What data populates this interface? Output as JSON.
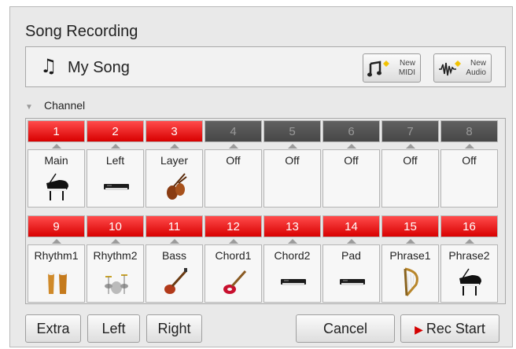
{
  "window": {
    "title": "Song Recording"
  },
  "song": {
    "name": "My Song",
    "note_glyph": "♫"
  },
  "new_buttons": [
    {
      "line1": "New",
      "line2": "MIDI",
      "icon": "midi-note-icon"
    },
    {
      "line1": "New",
      "line2": "Audio",
      "icon": "audio-wave-icon"
    }
  ],
  "channel_section": {
    "label": "Channel"
  },
  "channels_row1": [
    {
      "num": "1",
      "voice": "Main",
      "active": true,
      "icon": "grand-piano-icon"
    },
    {
      "num": "2",
      "voice": "Left",
      "active": true,
      "icon": "keyboard-icon"
    },
    {
      "num": "3",
      "voice": "Layer",
      "active": true,
      "icon": "strings-icon"
    },
    {
      "num": "4",
      "voice": "Off",
      "active": false,
      "icon": ""
    },
    {
      "num": "5",
      "voice": "Off",
      "active": false,
      "icon": ""
    },
    {
      "num": "6",
      "voice": "Off",
      "active": false,
      "icon": ""
    },
    {
      "num": "7",
      "voice": "Off",
      "active": false,
      "icon": ""
    },
    {
      "num": "8",
      "voice": "Off",
      "active": false,
      "icon": ""
    }
  ],
  "channels_row2": [
    {
      "num": "9",
      "voice": "Rhythm1",
      "active": true,
      "icon": "conga-icon"
    },
    {
      "num": "10",
      "voice": "Rhythm2",
      "active": true,
      "icon": "drum-kit-icon"
    },
    {
      "num": "11",
      "voice": "Bass",
      "active": true,
      "icon": "bass-guitar-icon"
    },
    {
      "num": "12",
      "voice": "Chord1",
      "active": true,
      "icon": "electric-guitar-icon"
    },
    {
      "num": "13",
      "voice": "Chord2",
      "active": true,
      "icon": "keyboard-icon"
    },
    {
      "num": "14",
      "voice": "Pad",
      "active": true,
      "icon": "keyboard-icon"
    },
    {
      "num": "15",
      "voice": "Phrase1",
      "active": true,
      "icon": "harp-icon"
    },
    {
      "num": "16",
      "voice": "Phrase2",
      "active": true,
      "icon": "grand-piano-icon"
    }
  ],
  "bottom": {
    "extra": "Extra",
    "left": "Left",
    "right": "Right",
    "cancel": "Cancel",
    "rec_glyph": "▶",
    "rec_start": "Rec Start"
  },
  "colors": {
    "active_channel": "#e60000",
    "inactive_channel": "#555555",
    "panel": "#e9e9e9"
  }
}
